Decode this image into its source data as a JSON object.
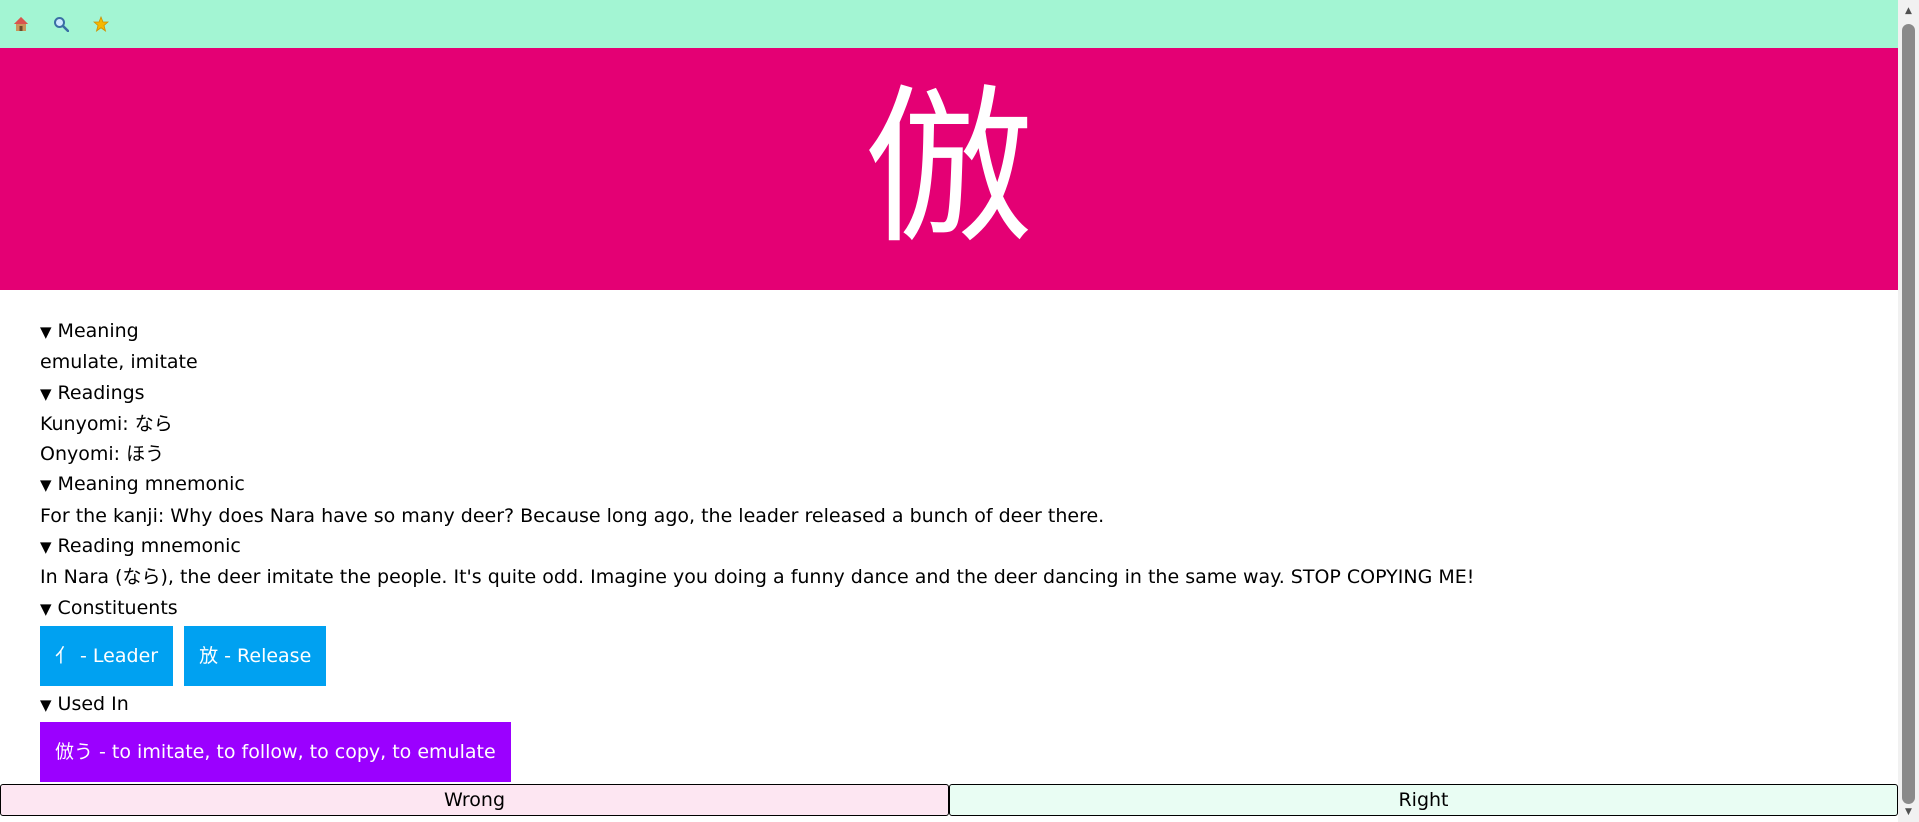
{
  "toolbar": {
    "icons": [
      "home-icon",
      "search-icon",
      "star-icon"
    ]
  },
  "kanji": {
    "character": "倣"
  },
  "sections": {
    "meaning": {
      "label": "Meaning",
      "value": "emulate, imitate"
    },
    "readings": {
      "label": "Readings",
      "kunyomi": "Kunyomi: なら",
      "onyomi": "Onyomi: ほう"
    },
    "meaning_mnemonic": {
      "label": "Meaning mnemonic",
      "text": "For the kanji: Why does Nara have so many deer? Because long ago, the leader released a bunch of deer there."
    },
    "reading_mnemonic": {
      "label": "Reading mnemonic",
      "text": "In Nara (なら), the deer imitate the people. It's quite odd. Imagine you doing a funny dance and the deer dancing in the same way. STOP COPYING ME!"
    },
    "constituents": {
      "label": "Constituents",
      "items": [
        "亻 - Leader",
        "放 - Release"
      ]
    },
    "used_in": {
      "label": "Used In",
      "items": [
        "倣う - to imitate, to follow, to copy, to emulate"
      ]
    }
  },
  "answers": {
    "wrong": "Wrong",
    "right": "Right"
  },
  "colors": {
    "topbar": "#a3f5d3",
    "hero": "#e40074",
    "constituent_chip": "#00a1f1",
    "used_in_chip": "#9b00ff",
    "wrong_bg": "#fde6f2",
    "right_bg": "#e9fdf3"
  }
}
